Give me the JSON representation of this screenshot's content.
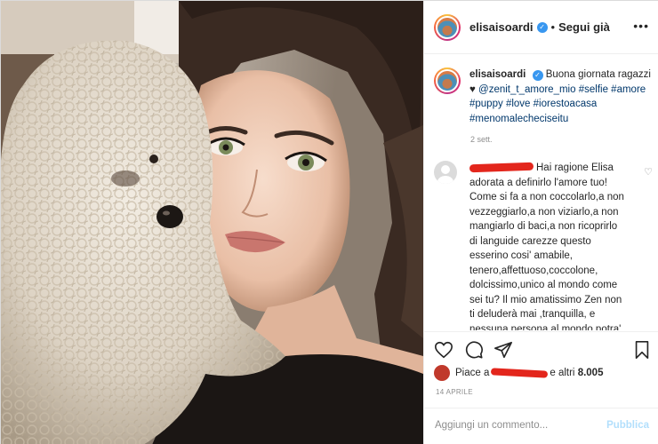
{
  "post": {
    "author": {
      "username": "elisaisoardi",
      "verified_icon": "verified-badge-icon",
      "separator": "•",
      "follow_label": "Segui già"
    },
    "more_icon": "more-options-icon",
    "caption": {
      "username": "elisaisoardi",
      "text_lead": "Buona giornata ragazzi ♥ ",
      "mention": "@zenit_t_amore_mio",
      "hashtags": [
        "#selfie",
        "#amore",
        "#puppy",
        "#love",
        "#iorestoacasa",
        "#menomalecheciseitu"
      ],
      "time": "2 sett."
    },
    "comment": {
      "text": "Hai ragione Elisa adorata a definirlo l'amore tuo! Come si fa a non coccolarlo,a non vezzeggiarlo,a non viziarlo,a non mangiarlo di baci,a non ricoprirlo di languide carezze questo esserino cosi' amabile, tenero,affettuoso,coccolone, dolcissimo,unico al mondo come sei tu? Il mio amatissimo Zen non ti deluderà mai ,tranquilla, e nessuna persona al mondo potra' mai competere per quanto",
      "like_icon": "heart-outline-icon"
    },
    "actions": {
      "like_icon": "heart-icon",
      "comment_icon": "comment-icon",
      "share_icon": "share-icon",
      "save_icon": "bookmark-icon"
    },
    "likes": {
      "prefix": "Piace a",
      "suffix": "e altri",
      "count": "8.005"
    },
    "date": "14 APRILE",
    "add_comment": {
      "placeholder": "Aggiungi un commento...",
      "publish_label": "Pubblica"
    }
  },
  "colors": {
    "link": "#00376b",
    "verified": "#3897f0",
    "publish_disabled": "#b2dffc",
    "redaction": "#e3261c"
  }
}
